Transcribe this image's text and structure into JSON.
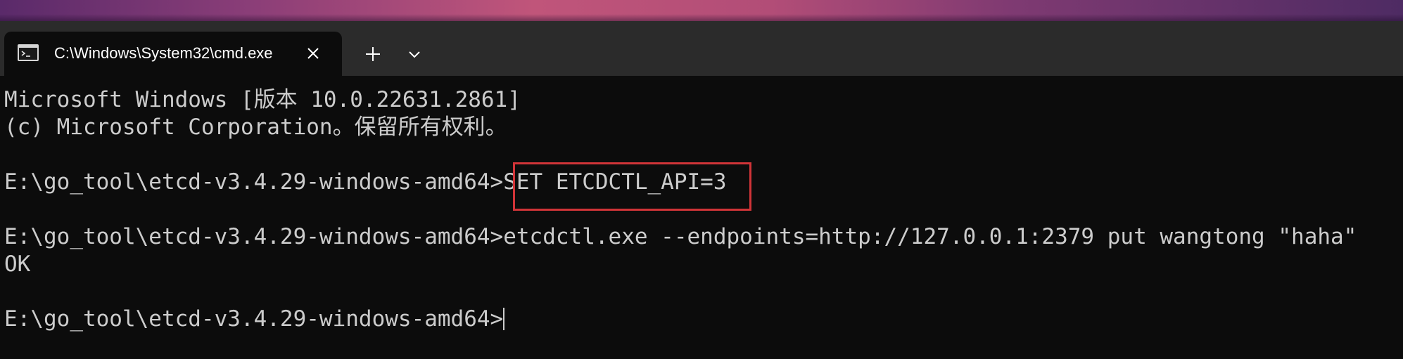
{
  "tab": {
    "title": "C:\\Windows\\System32\\cmd.exe",
    "icon": "cmd-icon"
  },
  "buttons": {
    "close_icon": "close-icon",
    "new_tab_icon": "plus-icon",
    "dropdown_icon": "chevron-down-icon"
  },
  "console": {
    "lines": [
      "Microsoft Windows [版本 10.0.22631.2861]",
      "(c) Microsoft Corporation。保留所有权利。",
      "",
      "E:\\go_tool\\etcd-v3.4.29-windows-amd64>SET ETCDCTL_API=3",
      "",
      "E:\\go_tool\\etcd-v3.4.29-windows-amd64>etcdctl.exe --endpoints=http://127.0.0.1:2379 put wangtong \"haha\"",
      "OK",
      "",
      "E:\\go_tool\\etcd-v3.4.29-windows-amd64>"
    ]
  },
  "colors": {
    "console_background": "#0c0c0c",
    "console_text": "#cccccc",
    "titlebar": "#2b2b2b",
    "highlight_border": "#d13438"
  }
}
